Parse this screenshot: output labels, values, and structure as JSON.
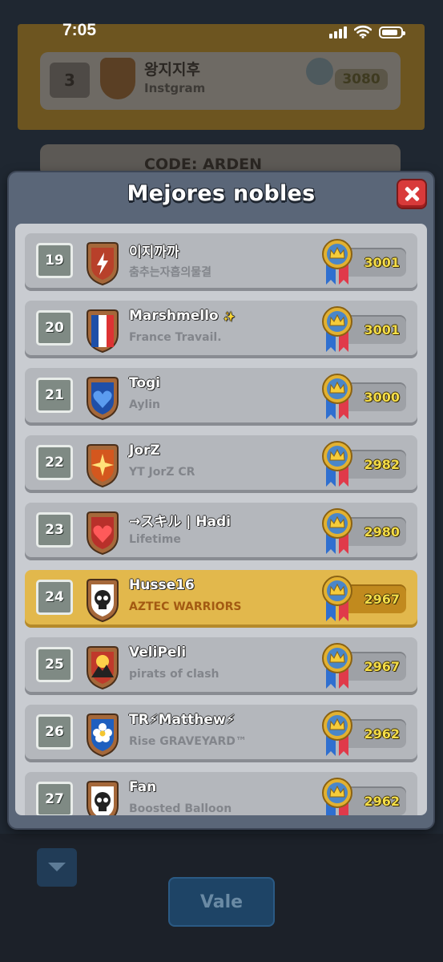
{
  "status_bar": {
    "time": "7:05"
  },
  "background": {
    "rows": [
      {
        "rank": "3",
        "name": "왕지지후",
        "clan": "Instgram",
        "score": "3080"
      },
      {
        "name": "CODE: ARDEN"
      }
    ],
    "vale_button": "Vale"
  },
  "modal": {
    "title": "Mejores nobles",
    "rows": [
      {
        "rank": "19",
        "name": "이지까까",
        "clan": "춤추는자흡의물결",
        "score": "3001",
        "badge_color": "#b8402a",
        "emblem": "lightning",
        "highlight": false
      },
      {
        "rank": "20",
        "name": "Marshmello",
        "name_suffix": "✨",
        "clan": "France Travail.",
        "score": "3001",
        "badge_color": "#b8402a",
        "emblem": "flag-france",
        "highlight": false
      },
      {
        "rank": "21",
        "name": "Togi",
        "clan": "Aylin",
        "score": "3000",
        "badge_color": "#1f4fa8",
        "emblem": "heart-blue",
        "highlight": false
      },
      {
        "rank": "22",
        "name": "JorZ",
        "clan": "YT JorZ CR",
        "score": "2982",
        "badge_color": "#d4571e",
        "emblem": "star",
        "highlight": false
      },
      {
        "rank": "23",
        "name": "→スキル | Hadi",
        "clan": "Lifetime",
        "score": "2980",
        "badge_color": "#b8302a",
        "emblem": "heart-red",
        "highlight": false
      },
      {
        "rank": "24",
        "name": "Husse16",
        "clan": "AZTEC WARRIORS",
        "score": "2967",
        "badge_color": "#ffffff",
        "emblem": "skull",
        "highlight": true
      },
      {
        "rank": "25",
        "name": "VeliPeli",
        "clan": "pirats of clash",
        "score": "2967",
        "badge_color": "#c0392b",
        "emblem": "sun-mountain",
        "highlight": false
      },
      {
        "rank": "26",
        "name": "TR⚡Matthew⚡",
        "clan": "Rise GRAVEYARD™",
        "score": "2962",
        "badge_color": "#1f5fbf",
        "emblem": "flower",
        "highlight": false
      },
      {
        "rank": "27",
        "name": "Fan",
        "clan": "Boosted Balloon",
        "score": "2962",
        "badge_color": "#ffffff",
        "emblem": "skull",
        "highlight": false
      }
    ]
  },
  "colors": {
    "row_bg": "#b4b7bc",
    "highlight_bg": "#e2b84c",
    "score_text": "#f4dd48",
    "close_button": "#d83a3a"
  }
}
